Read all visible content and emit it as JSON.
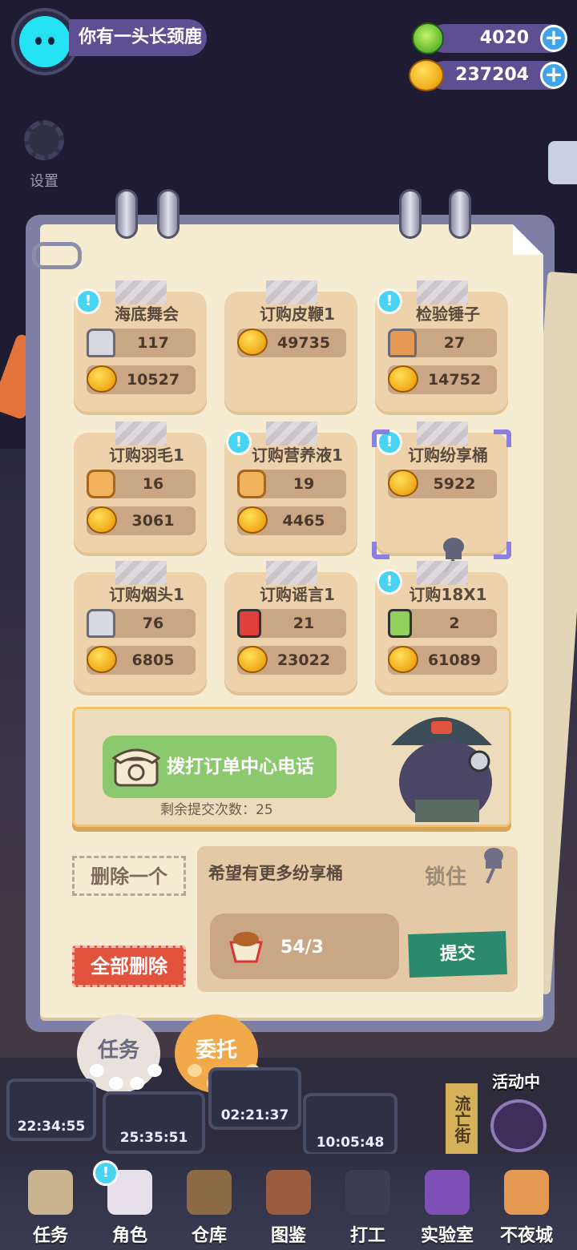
{
  "header": {
    "username": "你有一头长颈鹿",
    "gems": "4020",
    "coins": "237204",
    "settings_label": "设置"
  },
  "orders": [
    {
      "title": "海底舞会",
      "alert": true,
      "items": [
        {
          "icon": "bolt-icon",
          "value": "117"
        },
        {
          "icon": "coin-icon",
          "value": "10527"
        }
      ]
    },
    {
      "title": "订购皮鞭1",
      "alert": false,
      "items": [
        {
          "icon": "coin-icon",
          "value": "49735"
        }
      ]
    },
    {
      "title": "检验锤子",
      "alert": true,
      "items": [
        {
          "icon": "bronze-bolt-icon",
          "value": "27"
        },
        {
          "icon": "coin-icon",
          "value": "14752"
        }
      ]
    },
    {
      "title": "订购羽毛1",
      "alert": false,
      "items": [
        {
          "icon": "nut-icon",
          "value": "16"
        },
        {
          "icon": "coin-icon",
          "value": "3061"
        }
      ]
    },
    {
      "title": "订购营养液1",
      "alert": true,
      "items": [
        {
          "icon": "nut-icon",
          "value": "19"
        },
        {
          "icon": "coin-icon",
          "value": "4465"
        }
      ]
    },
    {
      "title": "订购纷享桶",
      "alert": true,
      "selected": true,
      "items": [
        {
          "icon": "coin-icon",
          "value": "5922"
        }
      ]
    },
    {
      "title": "订购烟头1",
      "alert": false,
      "items": [
        {
          "icon": "bolt-icon",
          "value": "76"
        },
        {
          "icon": "coin-icon",
          "value": "6805"
        }
      ]
    },
    {
      "title": "订购谣言1",
      "alert": false,
      "items": [
        {
          "icon": "red-battery-icon",
          "value": "21"
        },
        {
          "icon": "coin-icon",
          "value": "23022"
        }
      ]
    },
    {
      "title": "订购18X1",
      "alert": true,
      "items": [
        {
          "icon": "green-battery-icon",
          "value": "2"
        },
        {
          "icon": "coin-icon",
          "value": "61089"
        }
      ]
    }
  ],
  "phone": {
    "button_label": "拨打订单中心电话",
    "remaining": "剩余提交次数：25"
  },
  "actions": {
    "delete_one": "删除一个",
    "delete_all": "全部删除"
  },
  "detail": {
    "title": "希望有更多纷享桶",
    "lock_label": "锁住",
    "progress": "54/3",
    "submit": "提交"
  },
  "tabs": {
    "task": "任务",
    "commission": "委托"
  },
  "timers": [
    "22:34:55",
    "25:35:51",
    "02:21:37",
    "10:05:48"
  ],
  "side": {
    "activity": "活动中",
    "street": "流亡街"
  },
  "nav": [
    "任务",
    "角色",
    "仓库",
    "图鉴",
    "打工",
    "实验室",
    "不夜城"
  ],
  "colors": {
    "accent_purple": "#5d4f92",
    "call_green": "#8cc96e",
    "delete_red": "#e2533d",
    "submit_green": "#2b8a6b"
  }
}
